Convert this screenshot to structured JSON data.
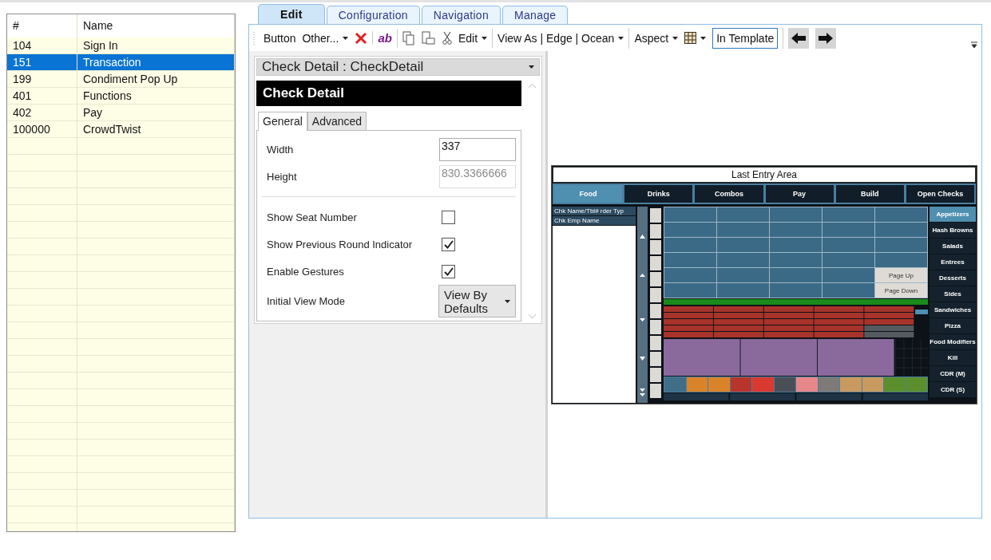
{
  "screen_list": {
    "columns": [
      "#",
      "Name"
    ],
    "rows": [
      {
        "number": "104",
        "name": "Sign In",
        "selected": false
      },
      {
        "number": "151",
        "name": "Transaction",
        "selected": true
      },
      {
        "number": "199",
        "name": "Condiment Pop Up",
        "selected": false
      },
      {
        "number": "401",
        "name": "Functions",
        "selected": false
      },
      {
        "number": "402",
        "name": "Pay",
        "selected": false
      },
      {
        "number": "100000",
        "name": "CrowdTwist",
        "selected": false
      }
    ]
  },
  "tabs": [
    {
      "label": "Edit",
      "selected": true
    },
    {
      "label": "Configuration",
      "selected": false
    },
    {
      "label": "Navigation",
      "selected": false
    },
    {
      "label": "Manage",
      "selected": false
    }
  ],
  "toolbar": [
    [
      {
        "kind": "text",
        "label": "Button"
      },
      {
        "kind": "dropdown",
        "label": "Other..."
      },
      {
        "kind": "delete"
      }
    ],
    [
      {
        "kind": "style",
        "label": "ab"
      }
    ],
    [
      {
        "kind": "copy"
      },
      {
        "kind": "paste"
      },
      {
        "kind": "cut"
      },
      {
        "kind": "dropdown",
        "label": "Edit"
      }
    ],
    [
      {
        "kind": "dropdown",
        "label": "View As | Edge | Ocean"
      }
    ],
    [
      {
        "kind": "dropdown",
        "label": "Aspect"
      },
      {
        "kind": "grid"
      },
      {
        "kind": "outlined",
        "label": "In Template"
      }
    ],
    [
      {
        "kind": "back"
      },
      {
        "kind": "forward"
      }
    ]
  ],
  "properties": {
    "selector": "Check Detail : CheckDetail",
    "header": "Check Detail",
    "tabs": [
      {
        "label": "General",
        "selected": true
      },
      {
        "label": "Advanced",
        "selected": false
      }
    ],
    "fields": [
      {
        "label": "Width",
        "value": "337",
        "disabled": false
      },
      {
        "label": "Height",
        "value": "830.3366666",
        "disabled": true
      }
    ],
    "options": [
      {
        "kind": "checkbox",
        "label": "Show Seat Number",
        "checked": false
      },
      {
        "kind": "checkbox",
        "label": "Show Previous Round Indicator",
        "checked": true
      },
      {
        "kind": "checkbox",
        "label": "Enable Gestures",
        "checked": true
      },
      {
        "kind": "dropdown",
        "label": "Initial View Mode",
        "value": "View By Defaults"
      }
    ]
  },
  "preview": {
    "title": "Last Entry Area",
    "tabs": [
      {
        "label": "Food",
        "selected": true
      },
      {
        "label": "Drinks",
        "selected": false
      },
      {
        "label": "Combos",
        "selected": false
      },
      {
        "label": "Pay",
        "selected": false
      },
      {
        "label": "Build",
        "selected": false
      },
      {
        "label": "Open Checks",
        "selected": false
      }
    ],
    "check_lines": [
      "Chk Name/Tbl# rder Typ",
      "Chk Emp Name"
    ],
    "page_buttons": [
      "Page Up",
      "Page Down"
    ],
    "categories": [
      {
        "label": "Appetizers",
        "selected": true
      },
      {
        "label": "Hash Browns",
        "selected": false
      },
      {
        "label": "Salads",
        "selected": false
      },
      {
        "label": "Entrees",
        "selected": false
      },
      {
        "label": "Desserts",
        "selected": false
      },
      {
        "label": "Sides",
        "selected": false
      },
      {
        "label": "Sandwiches",
        "selected": false
      },
      {
        "label": "Pizza",
        "selected": false
      },
      {
        "label": "Food Modifiers",
        "selected": false
      },
      {
        "label": "Kill",
        "selected": false
      },
      {
        "label": "CDR (M)",
        "selected": false
      },
      {
        "label": "CDR (S)",
        "selected": false
      }
    ],
    "function_buttons": [
      {
        "color": "#3f6e86"
      },
      {
        "color": "#d9832a"
      },
      {
        "color": "#d9832a"
      },
      {
        "color": "#b8352c"
      },
      {
        "color": "#d9392f"
      },
      {
        "color": "#4a4f55"
      },
      {
        "color": "#e8878a"
      },
      {
        "color": "#7d7a78"
      },
      {
        "color": "#c99a5f"
      },
      {
        "color": "#c99a5f"
      },
      {
        "color": "#5b8f2e"
      },
      {
        "color": "#5b8f2e"
      }
    ]
  }
}
